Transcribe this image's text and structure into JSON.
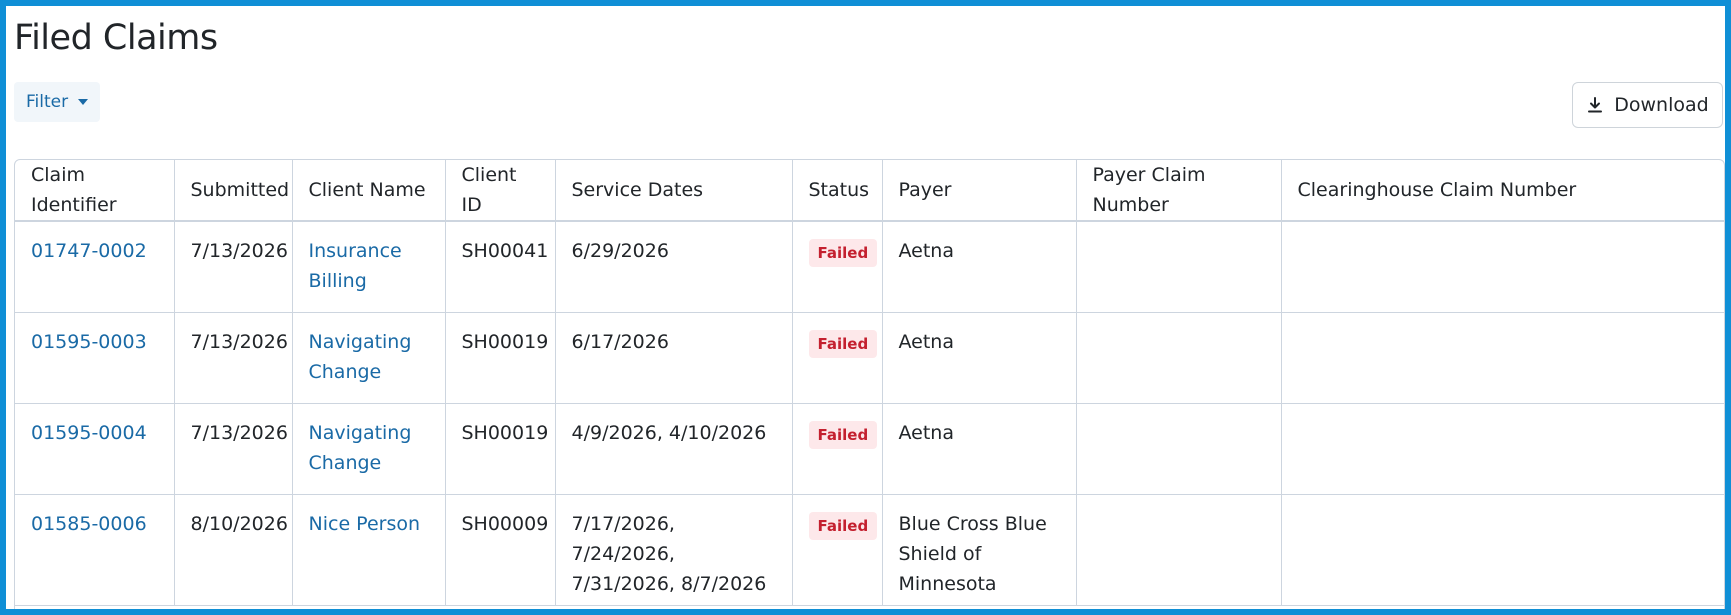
{
  "page": {
    "title": "Filed Claims"
  },
  "toolbar": {
    "filter_label": "Filter",
    "download_label": "Download"
  },
  "table": {
    "headers": [
      "Claim Identifier",
      "Submitted",
      "Client Name",
      "Client ID",
      "Service Dates",
      "Status",
      "Payer",
      "Payer Claim Number",
      "Clearinghouse Claim Number"
    ],
    "rows": [
      {
        "claim_id": "01747-0002",
        "submitted": "7/13/2026",
        "client_name": "Insurance Billing",
        "client_id": "SH00041",
        "service_dates": "6/29/2026",
        "status": "Failed",
        "payer": "Aetna",
        "payer_claim_number": "",
        "clearinghouse_claim_number": ""
      },
      {
        "claim_id": "01595-0003",
        "submitted": "7/13/2026",
        "client_name": "Navigating Change",
        "client_id": "SH00019",
        "service_dates": "6/17/2026",
        "status": "Failed",
        "payer": "Aetna",
        "payer_claim_number": "",
        "clearinghouse_claim_number": ""
      },
      {
        "claim_id": "01595-0004",
        "submitted": "7/13/2026",
        "client_name": "Navigating Change",
        "client_id": "SH00019",
        "service_dates": "4/9/2026, 4/10/2026",
        "status": "Failed",
        "payer": "Aetna",
        "payer_claim_number": "",
        "clearinghouse_claim_number": ""
      },
      {
        "claim_id": "01585-0006",
        "submitted": "8/10/2026",
        "client_name": "Nice Person",
        "client_id": "SH00009",
        "service_dates": "7/17/2026, 7/24/2026, 7/31/2026, 8/7/2026",
        "status": "Failed",
        "payer": "Blue Cross Blue Shield of Minnesota",
        "payer_claim_number": "",
        "clearinghouse_claim_number": ""
      }
    ]
  },
  "colors": {
    "accent": "#1a6aa6",
    "frame": "#0f8fd6",
    "failed_text": "#c4202f",
    "failed_bg": "#fde8ea"
  },
  "icons": {
    "download": "download-icon",
    "filter_caret": "caret-down-icon"
  }
}
